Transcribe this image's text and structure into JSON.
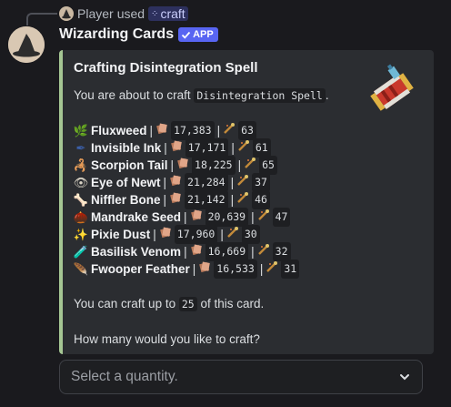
{
  "reply": {
    "user": "Player",
    "verb": "used",
    "command": "craft"
  },
  "author": {
    "name": "Wizarding Cards",
    "badge": "APP"
  },
  "embed": {
    "accent": "#a5c693",
    "title": "Crafting Disintegration Spell",
    "intro_prefix": "You are about to craft",
    "intro_item": "Disintegration Spell",
    "intro_suffix": ".",
    "ingredients": [
      {
        "icon": "fluxweed-icon",
        "emoji": "🌿",
        "color": "#c2873a",
        "name": "Fluxweed",
        "a": "17,383",
        "b": "63"
      },
      {
        "icon": "invisible-ink-icon",
        "emoji": "✒",
        "color": "#3b5fa8",
        "name": "Invisible Ink",
        "a": "17,171",
        "b": "61"
      },
      {
        "icon": "scorpion-tail-icon",
        "emoji": "🦂",
        "color": "#d6312c",
        "name": "Scorpion Tail",
        "a": "18,225",
        "b": "65"
      },
      {
        "icon": "eye-of-newt-icon",
        "emoji": "👁",
        "color": "#d8d2c4",
        "name": "Eye of Newt",
        "a": "21,284",
        "b": "37"
      },
      {
        "icon": "niffler-bone-icon",
        "emoji": "🦴",
        "color": "#e6dfc9",
        "name": "Niffler Bone",
        "a": "21,142",
        "b": "46"
      },
      {
        "icon": "mandrake-seed-icon",
        "emoji": "🌰",
        "color": "#8a5a2f",
        "name": "Mandrake Seed",
        "a": "20,639",
        "b": "47"
      },
      {
        "icon": "pixie-dust-icon",
        "emoji": "✨",
        "color": "#8a4bd6",
        "name": "Pixie Dust",
        "a": "17,960",
        "b": "30"
      },
      {
        "icon": "basilisk-venom-icon",
        "emoji": "🧪",
        "color": "#4cbf5c",
        "name": "Basilisk Venom",
        "a": "16,669",
        "b": "32"
      },
      {
        "icon": "fwooper-feather-icon",
        "emoji": "🪶",
        "color": "#3aa0e0",
        "name": "Fwooper Feather",
        "a": "16,533",
        "b": "31"
      }
    ],
    "craft_prefix": "You can craft up to",
    "craft_count": "25",
    "craft_suffix": "of this card.",
    "question": "How many would you like to craft?"
  },
  "select": {
    "placeholder": "Select a quantity."
  }
}
